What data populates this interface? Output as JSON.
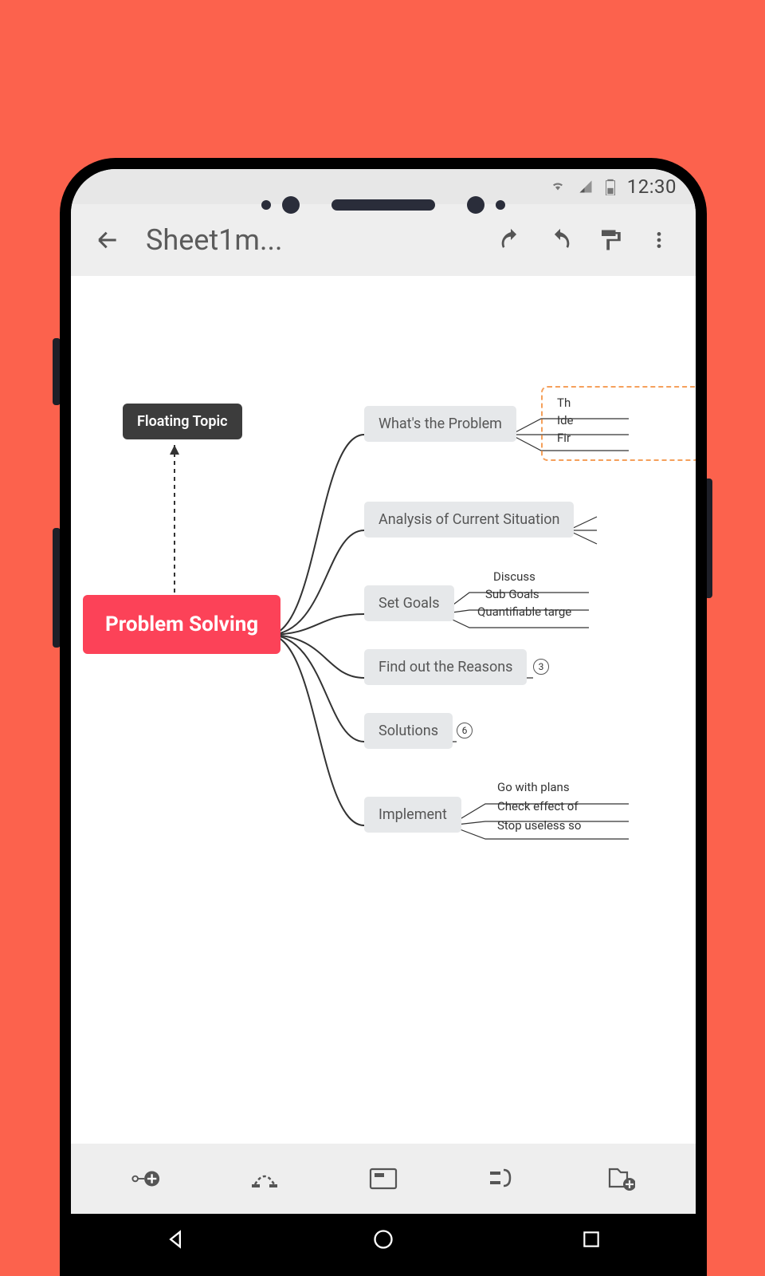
{
  "status": {
    "time": "12:30"
  },
  "app_bar": {
    "title": "Sheet1m..."
  },
  "mindmap": {
    "floating_topic": "Floating Topic",
    "root": "Problem Solving",
    "branches": [
      {
        "label": "What's the Problem",
        "leaves": [
          "Th",
          "Ide",
          "Fir"
        ]
      },
      {
        "label": "Analysis of Current Situation"
      },
      {
        "label": "Set Goals",
        "leaves": [
          "Discuss",
          "Sub Goals",
          "Quantifiable targe"
        ]
      },
      {
        "label": "Find out the Reasons",
        "count": "3"
      },
      {
        "label": "Solutions",
        "count": "6"
      },
      {
        "label": "Implement",
        "leaves": [
          "Go with plans",
          "Check effect of",
          "Stop useless so"
        ]
      }
    ]
  }
}
